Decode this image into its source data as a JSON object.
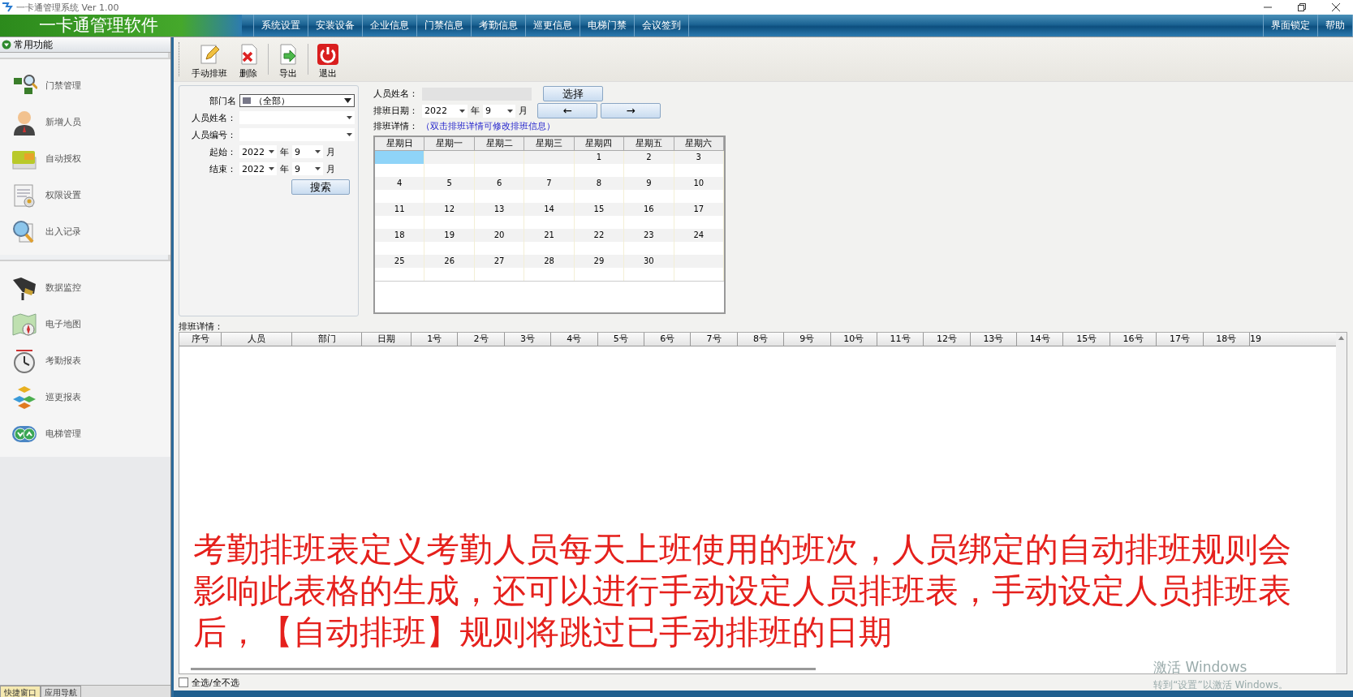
{
  "window": {
    "title": "一卡通管理系统  Ver 1.00"
  },
  "header": {
    "title": "一卡通管理软件",
    "menu": [
      "系统设置",
      "安装设备",
      "企业信息",
      "门禁信息",
      "考勤信息",
      "巡更信息",
      "电梯门禁",
      "会议签到"
    ],
    "right_menu": [
      "界面锁定",
      "帮助"
    ]
  },
  "sidebar": {
    "section": "常用功能",
    "groups": [
      [
        "门禁管理",
        "新增人员",
        "自动授权",
        "权限设置",
        "出入记录"
      ],
      [
        "数据监控",
        "电子地图",
        "考勤报表",
        "巡更报表",
        "电梯管理"
      ]
    ],
    "tabs": [
      {
        "label": "快捷窗口",
        "selected": true
      },
      {
        "label": "应用导航",
        "selected": false
      }
    ]
  },
  "toolbar": [
    "手动排班",
    "删除",
    "导出",
    "退出"
  ],
  "filter": {
    "department_label": "部门名",
    "department_value": "（全部）",
    "name_label": "人员姓名：",
    "number_label": "人员编号：",
    "period_rows": [
      {
        "label": "起始：",
        "year": "2022",
        "year_unit": "年",
        "month": "9",
        "month_unit": "月"
      },
      {
        "label": "结束：",
        "year": "2022",
        "year_unit": "年",
        "month": "9",
        "month_unit": "月"
      }
    ],
    "search_button": "搜索"
  },
  "schedule": {
    "name_label": "人员姓名：",
    "select_button": "选择",
    "date_label": "排班日期：",
    "year": "2022",
    "year_unit": "年",
    "month": "9",
    "month_unit": "月",
    "prev_button": "←",
    "next_button": "→",
    "detail_label": "排班详情：",
    "detail_hint": "（双击排班详情可修改排班信息）",
    "weekdays": [
      "星期日",
      "星期一",
      "星期二",
      "星期三",
      "星期四",
      "星期五",
      "星期六"
    ],
    "weeks": [
      [
        {
          "selected": true
        },
        {
          "selected": false
        },
        {
          "selected": false
        },
        {
          "selected": false
        },
        {
          "day": "1",
          "selected": false
        },
        {
          "day": "2",
          "selected": false
        },
        {
          "day": "3",
          "selected": false
        }
      ],
      [
        {
          "day": "4",
          "selected": false
        },
        {
          "day": "5",
          "selected": false
        },
        {
          "day": "6",
          "selected": false
        },
        {
          "day": "7",
          "selected": false
        },
        {
          "day": "8",
          "selected": false
        },
        {
          "day": "9",
          "selected": false
        },
        {
          "day": "10",
          "selected": false
        }
      ],
      [
        {
          "day": "11",
          "selected": false
        },
        {
          "day": "12",
          "selected": false
        },
        {
          "day": "13",
          "selected": false
        },
        {
          "day": "14",
          "selected": false
        },
        {
          "day": "15",
          "selected": false
        },
        {
          "day": "16",
          "selected": false
        },
        {
          "day": "17",
          "selected": false
        }
      ],
      [
        {
          "day": "18",
          "selected": false
        },
        {
          "day": "19",
          "selected": false
        },
        {
          "day": "20",
          "selected": false
        },
        {
          "day": "21",
          "selected": false
        },
        {
          "day": "22",
          "selected": false
        },
        {
          "day": "23",
          "selected": false
        },
        {
          "day": "24",
          "selected": false
        }
      ],
      [
        {
          "day": "25",
          "selected": false
        },
        {
          "day": "26",
          "selected": false
        },
        {
          "day": "27",
          "selected": false
        },
        {
          "day": "28",
          "selected": false
        },
        {
          "day": "29",
          "selected": false
        },
        {
          "day": "30",
          "selected": false
        },
        {
          "selected": false
        }
      ]
    ]
  },
  "table": {
    "title": "排班详情：",
    "columns": [
      "序号",
      "人员",
      "部门",
      "日期",
      "1号",
      "2号",
      "3号",
      "4号",
      "5号",
      "6号",
      "7号",
      "8号",
      "9号",
      "10号",
      "11号",
      "12号",
      "13号",
      "14号",
      "15号",
      "16号",
      "17号",
      "18号",
      "19"
    ]
  },
  "select_all": {
    "label": "全选/全不选",
    "checked": false
  },
  "caption": [
    "考勤排班表定义考勤人员每天上班使用的班次，人员绑定的自动排班规则会",
    "影响此表格的生成，还可以进行手动设定人员排班表，手动设定人员排班表",
    "后，【自动排班】规则将跳过已手动排班的日期"
  ],
  "os_notice": {
    "title": "激活 Windows",
    "hint": "转到“设置”以激活 Windows。"
  }
}
